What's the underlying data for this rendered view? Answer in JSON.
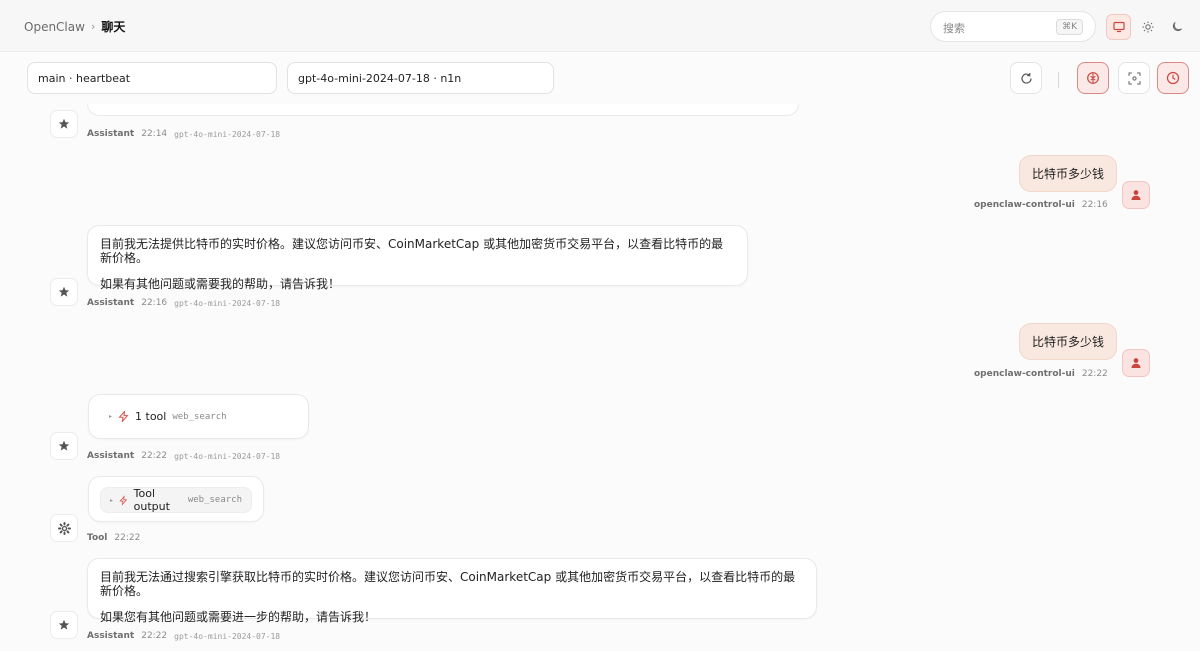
{
  "header": {
    "breadcrumb_root": "OpenClaw",
    "breadcrumb_sep": "›",
    "breadcrumb_current": "聊天",
    "search_placeholder": "搜索",
    "search_shortcut": "⌘K"
  },
  "controls": {
    "session": "main · heartbeat",
    "model": "gpt-4o-mini-2024-07-18 · n1n"
  },
  "messages": [
    {
      "role": "assistant",
      "sender": "Assistant",
      "time": "22:14",
      "model": "gpt-4o-mini-2024-07-18"
    },
    {
      "role": "user",
      "text": "比特币多少钱",
      "sender": "openclaw-control-ui",
      "time": "22:16"
    },
    {
      "role": "assistant",
      "lines": [
        "目前我无法提供比特币的实时价格。建议您访问币安、CoinMarketCap 或其他加密货币交易平台，以查看比特币的最新价格。",
        "如果有其他问题或需要我的帮助，请告诉我！"
      ],
      "sender": "Assistant",
      "time": "22:16",
      "model": "gpt-4o-mini-2024-07-18"
    },
    {
      "role": "user",
      "text": "比特币多少钱",
      "sender": "openclaw-control-ui",
      "time": "22:22"
    },
    {
      "role": "assistant",
      "tool_count": "1 tool",
      "tool_name": "web_search",
      "sender": "Assistant",
      "time": "22:22",
      "model": "gpt-4o-mini-2024-07-18"
    },
    {
      "role": "tool",
      "tool_label": "Tool output",
      "tool_name": "web_search",
      "sender": "Tool",
      "time": "22:22"
    },
    {
      "role": "assistant",
      "lines": [
        "目前我无法通过搜索引擎获取比特币的实时价格。建议您访问币安、CoinMarketCap 或其他加密货币交易平台，以查看比特币的最新价格。",
        "如果您有其他问题或需要进一步的帮助，请告诉我！"
      ],
      "sender": "Assistant",
      "time": "22:22",
      "model": "gpt-4o-mini-2024-07-18"
    }
  ],
  "icons": {
    "assistant_avatar": "star-icon",
    "user_avatar": "person-icon",
    "tool_avatar": "gear-icon",
    "tool_marker": "lightning-icon",
    "accent": "#d9534f"
  }
}
